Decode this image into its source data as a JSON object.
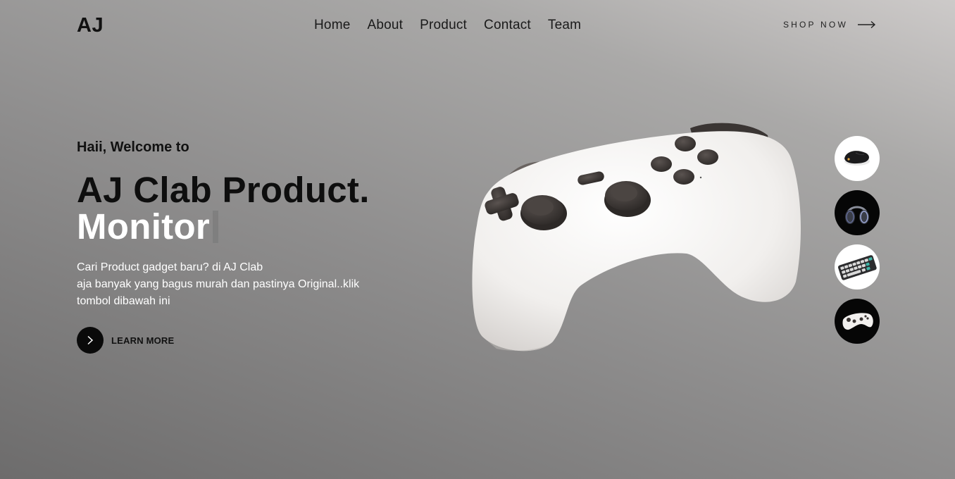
{
  "brand": {
    "logo": "AJ"
  },
  "nav": {
    "items": [
      {
        "label": "Home"
      },
      {
        "label": "About"
      },
      {
        "label": "Product"
      },
      {
        "label": "Contact"
      },
      {
        "label": "Team"
      }
    ]
  },
  "header": {
    "shop_label": "SHOP NOW",
    "shop_icon": "arrow-right-icon"
  },
  "hero": {
    "welcome": "Haii, Welcome to",
    "title_line1": "AJ Clab Product.",
    "title_line2": "Monitor",
    "description_lines": [
      "Cari Product gadget baru? di AJ Clab",
      "aja banyak yang bagus murah dan pastinya Original..klik",
      "tombol dibawah ini"
    ],
    "cta_label": "LEARN MORE",
    "cta_icon": "chevron-right-icon"
  },
  "product_thumbnails": [
    {
      "name": "mouse",
      "icon": "mouse-icon"
    },
    {
      "name": "headphones",
      "icon": "headphones-icon"
    },
    {
      "name": "keyboard",
      "icon": "keyboard-icon"
    },
    {
      "name": "controller",
      "icon": "gamepad-icon"
    }
  ],
  "colors": {
    "text_dark": "#111111",
    "text_light": "#ffffff",
    "cta_bg": "#0a0a0a"
  }
}
